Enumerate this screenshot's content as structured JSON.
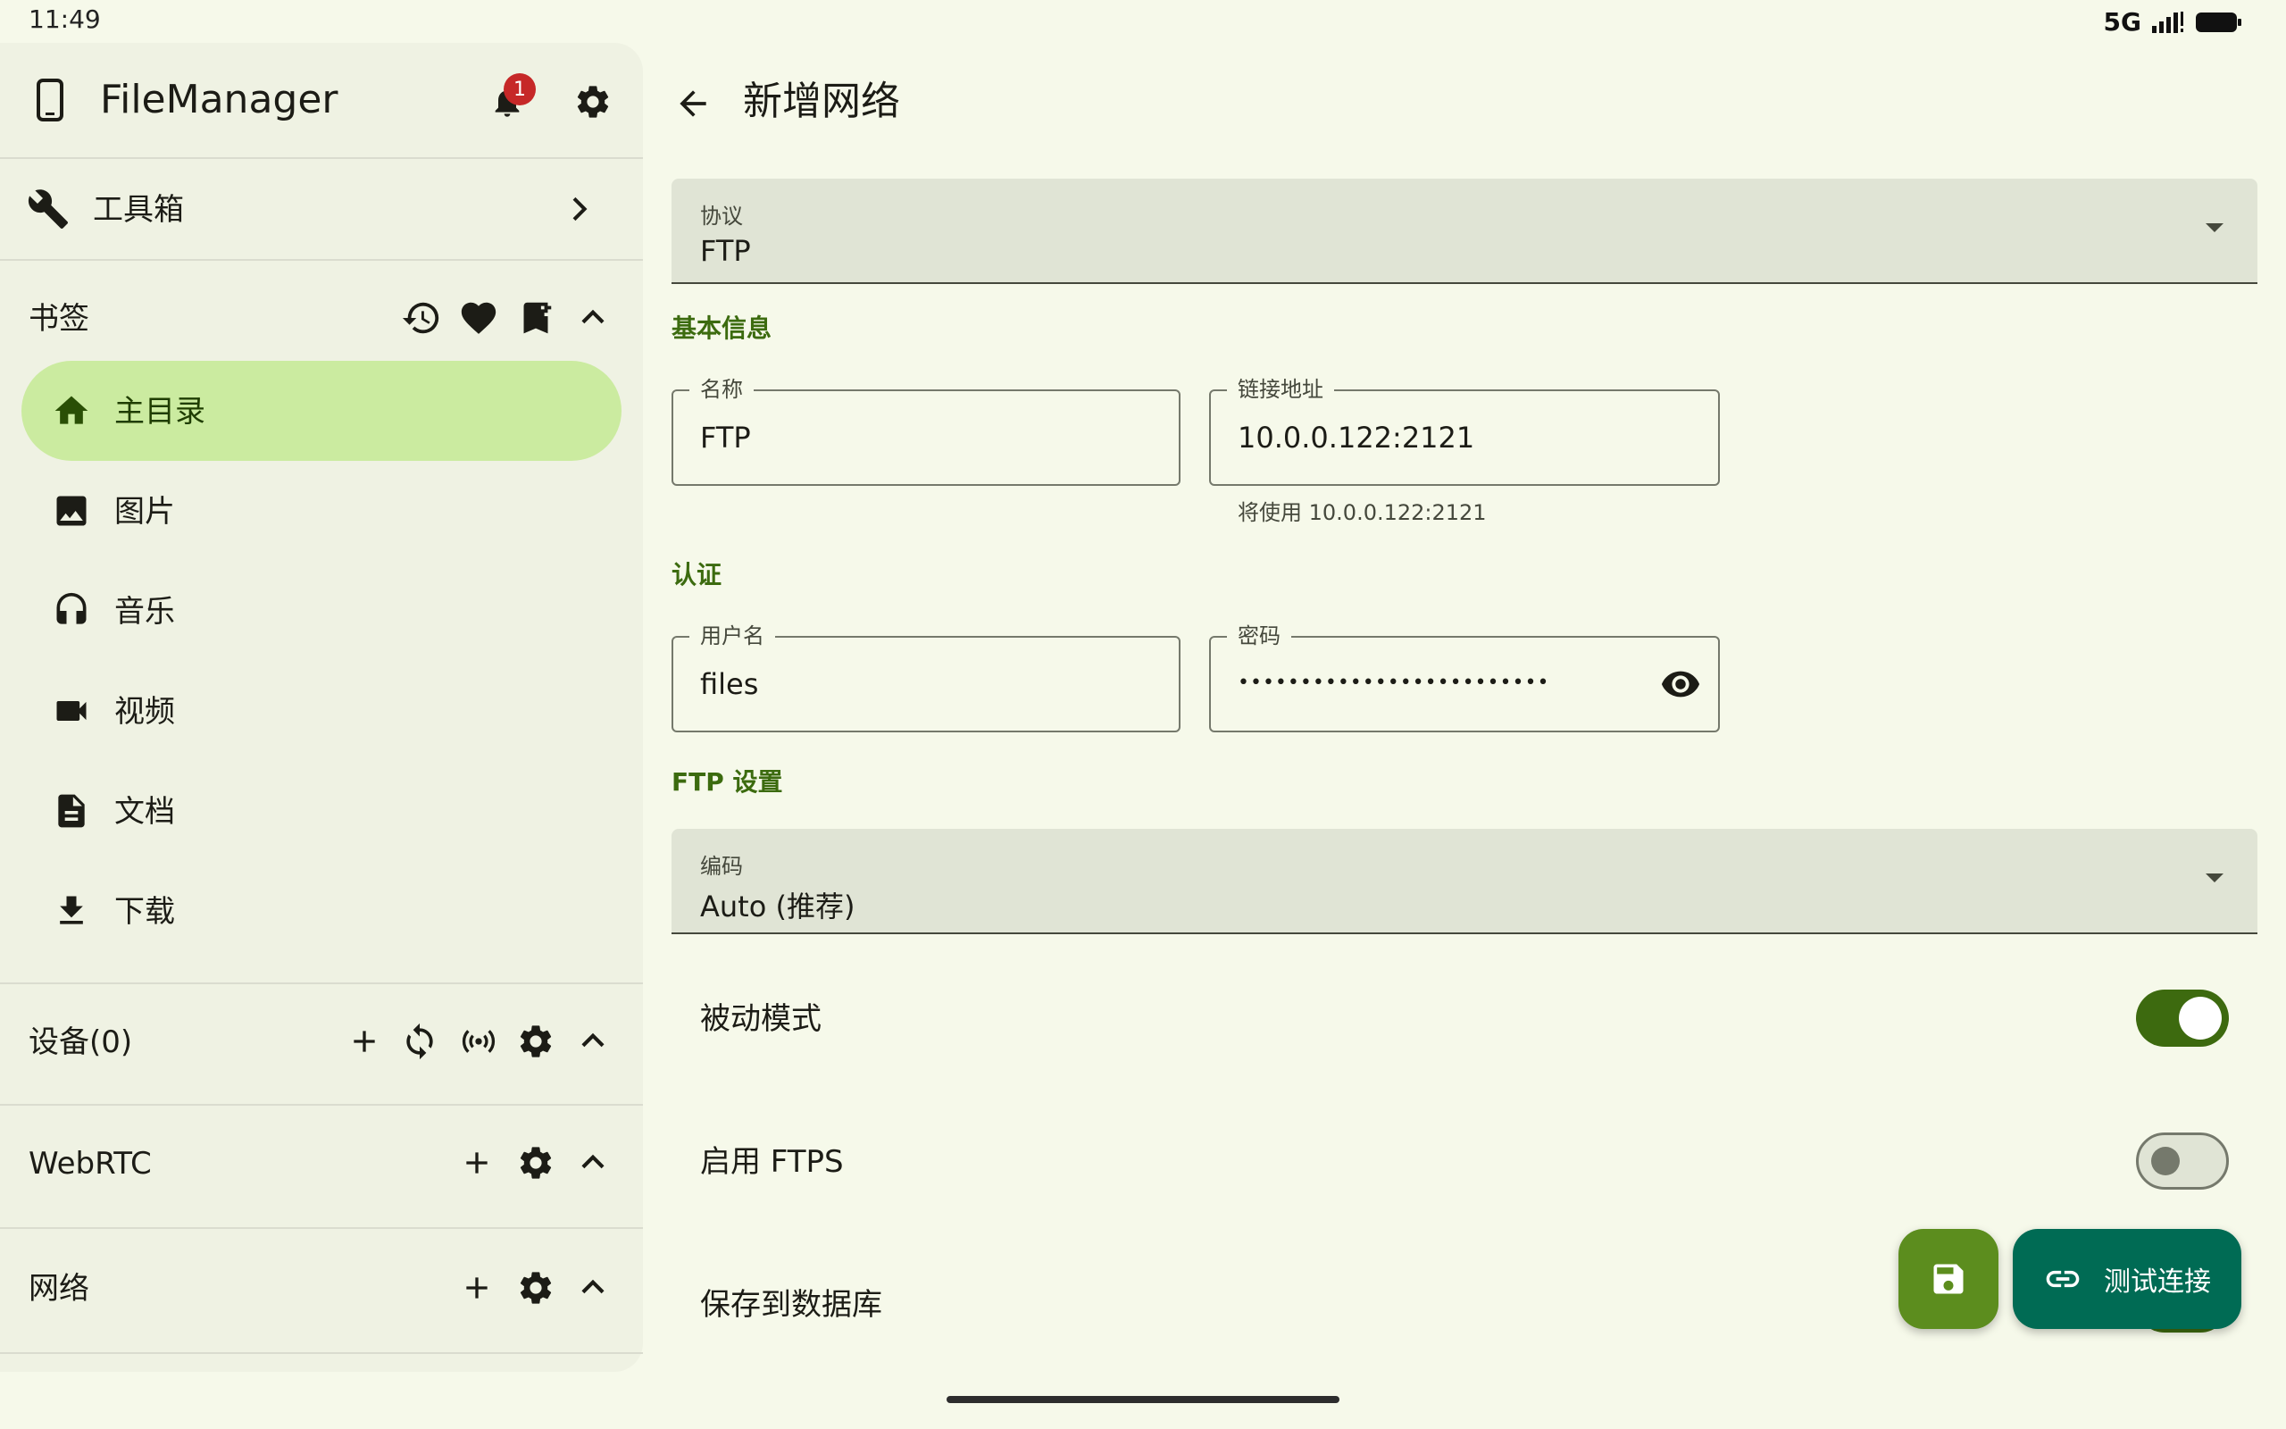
{
  "status_bar": {
    "time": "11:49",
    "network": "5G"
  },
  "sidebar": {
    "app_title": "FileManager",
    "notification_count": "1",
    "toolbox_label": "工具箱",
    "bookmarks": {
      "title": "书签",
      "items": [
        {
          "label": "主目录",
          "icon": "home-icon",
          "active": true
        },
        {
          "label": "图片",
          "icon": "image-icon"
        },
        {
          "label": "音乐",
          "icon": "headphones-icon"
        },
        {
          "label": "视频",
          "icon": "videocam-icon"
        },
        {
          "label": "文档",
          "icon": "document-icon"
        },
        {
          "label": "下载",
          "icon": "download-icon"
        }
      ]
    },
    "devices_title": "设备(0)",
    "webrtc_title": "WebRTC",
    "network_title": "网络"
  },
  "main": {
    "title": "新增网络",
    "protocol": {
      "label": "协议",
      "value": "FTP"
    },
    "basic_info_title": "基本信息",
    "name_field": {
      "label": "名称",
      "value": "FTP"
    },
    "address_field": {
      "label": "链接地址",
      "value": "10.0.0.122:2121",
      "helper": "将使用 10.0.0.122:2121"
    },
    "auth_title": "认证",
    "username_field": {
      "label": "用户名",
      "value": "files"
    },
    "password_field": {
      "label": "密码",
      "value": "•••••••••••••••••••••••••"
    },
    "ftp_settings_title": "FTP 设置",
    "encoding": {
      "label": "编码",
      "value": "Auto (推荐)"
    },
    "passive_mode": {
      "label": "被动模式",
      "enabled": true
    },
    "ftps": {
      "label": "启用 FTPS",
      "enabled": false
    },
    "save_to_db": {
      "label": "保存到数据库"
    },
    "test_connection_label": "测试连接"
  },
  "colors": {
    "background": "#f6f9ea",
    "sidebar": "#eff2e3",
    "active_bookmark": "#cbeba0",
    "accent_green": "#3d6a0f",
    "fab_save": "#5c8d1e",
    "fab_test": "#006b54"
  }
}
